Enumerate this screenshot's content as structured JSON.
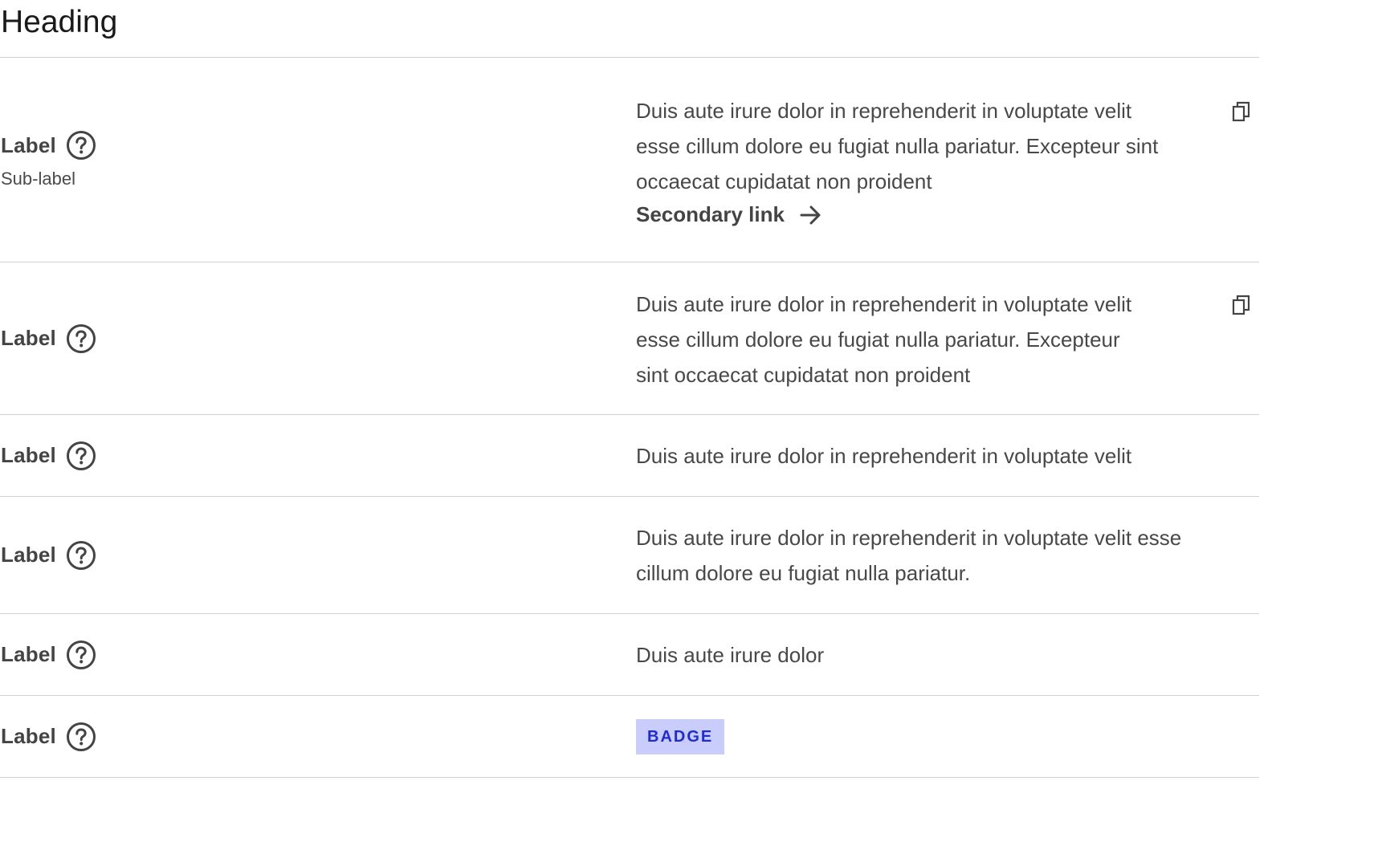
{
  "heading": "Heading",
  "rows": [
    {
      "label": "Label",
      "sublabel": "Sub-label",
      "value_lines": [
        "Duis aute irure dolor in reprehenderit in voluptate velit",
        "esse cillum dolore eu fugiat nulla pariatur. Excepteur sint",
        "occaecat cupidatat non proident"
      ],
      "link": "Secondary link",
      "copy": true
    },
    {
      "label": "Label",
      "value_lines": [
        "Duis aute irure dolor in reprehenderit in voluptate velit",
        "esse cillum dolore eu fugiat nulla pariatur. Excepteur",
        "sint occaecat cupidatat non proident"
      ],
      "copy": true
    },
    {
      "label": "Label",
      "value_lines": [
        "Duis aute irure dolor in reprehenderit in voluptate velit"
      ]
    },
    {
      "label": "Label",
      "value_lines": [
        "Duis aute irure dolor in reprehenderit in voluptate velit esse",
        "cillum dolore eu fugiat nulla pariatur."
      ]
    },
    {
      "label": "Label",
      "value_lines": [
        "Duis aute irure dolor"
      ]
    },
    {
      "label": "Label",
      "badge": "BADGE"
    }
  ],
  "icons": {
    "help": "help-circle-icon",
    "copy": "copy-icon",
    "arrow": "arrow-right-icon"
  },
  "colors": {
    "badge_bg": "#c9cdfc",
    "badge_text": "#1f2bd6",
    "divider": "#d0d0d0"
  }
}
